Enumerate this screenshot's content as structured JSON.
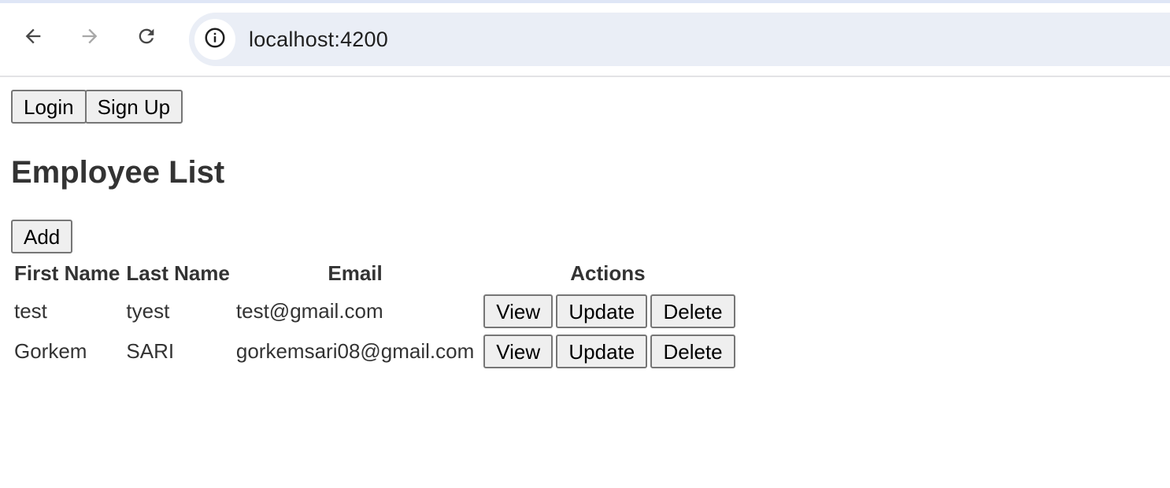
{
  "browser": {
    "back_icon": "arrow-left-icon",
    "forward_icon": "arrow-right-icon",
    "reload_icon": "reload-icon",
    "site_info_icon": "info-icon",
    "url": "localhost:4200"
  },
  "auth": {
    "login_label": "Login",
    "signup_label": "Sign Up"
  },
  "page": {
    "title": "Employee List",
    "add_label": "Add"
  },
  "table": {
    "headers": {
      "first_name": "First Name",
      "last_name": "Last Name",
      "email": "Email",
      "actions": "Actions"
    },
    "rows": [
      {
        "first_name": "test",
        "last_name": "tyest",
        "email": "test@gmail.com",
        "view": "View",
        "update": "Update",
        "delete": "Delete"
      },
      {
        "first_name": "Gorkem",
        "last_name": "SARI",
        "email": "gorkemsari08@gmail.com",
        "view": "View",
        "update": "Update",
        "delete": "Delete"
      }
    ]
  },
  "colors": {
    "text": "#333333",
    "button_bg": "#efefef",
    "button_border": "#767676",
    "omnibox_bg": "#eaeef6"
  }
}
